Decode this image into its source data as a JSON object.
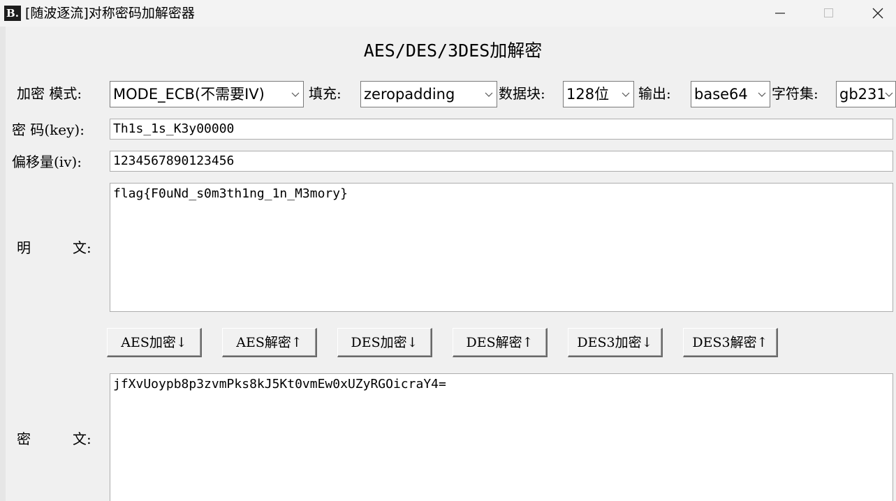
{
  "window": {
    "icon_text": "B.",
    "title": "[随波逐流]对称密码加解密器"
  },
  "heading": "AES/DES/3DES加解密",
  "options": {
    "mode_label": "加密 模式:",
    "mode_value": "MODE_ECB(不需要IV)",
    "padding_label": "填充:",
    "padding_value": "zeropadding",
    "block_label": "数据块:",
    "block_value": "128位",
    "output_label": "输出:",
    "output_value": "base64",
    "charset_label": "字符集:",
    "charset_value": "gb231"
  },
  "key": {
    "label": "密 码(key):",
    "value": "Th1s_1s_K3y00000"
  },
  "iv": {
    "label": "偏移量(iv):",
    "value": "1234567890123456"
  },
  "plaintext": {
    "label_a": "明",
    "label_b": "文:",
    "value": "flag{F0uNd_s0m3th1ng_1n_M3mory}"
  },
  "buttons": {
    "aes_encrypt": "AES加密↓",
    "aes_decrypt": "AES解密↑",
    "des_encrypt": "DES加密↓",
    "des_decrypt": "DES解密↑",
    "des3_encrypt": "DES3加密↓",
    "des3_decrypt": "DES3解密↑"
  },
  "ciphertext": {
    "label_a": "密",
    "label_b": "文:",
    "value": "jfXvUoypb8p3zvmPks8kJ5Kt0vmEw0xUZyRGOicraY4="
  }
}
